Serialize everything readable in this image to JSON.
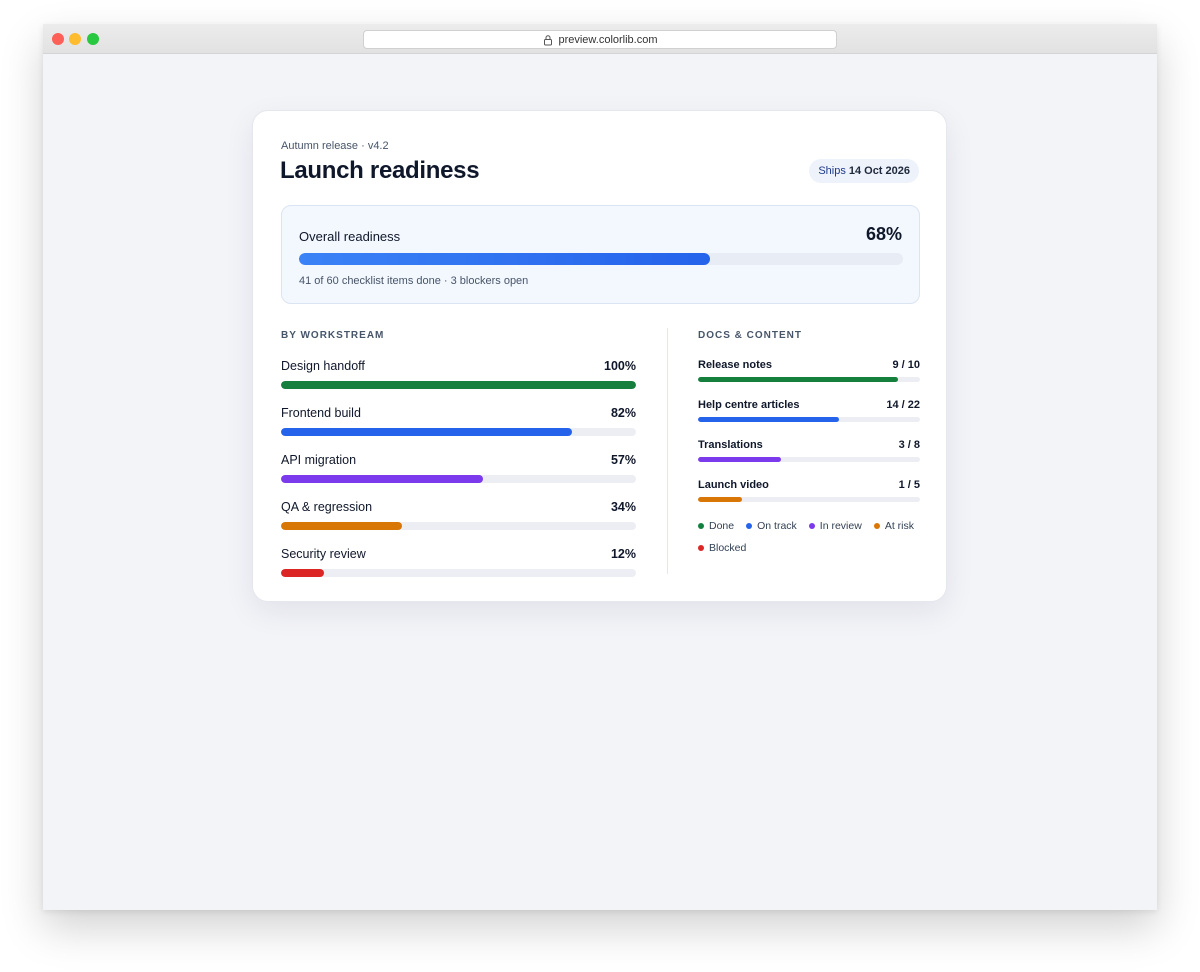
{
  "browser": {
    "url": "preview.colorlib.com"
  },
  "header": {
    "eyebrow": "Autumn release · v4.2",
    "title": "Launch readiness",
    "ship_prefix": "Ships",
    "ship_date": "14 Oct 2026"
  },
  "overall": {
    "label": "Overall readiness",
    "percent_label": "68%",
    "percent": 68,
    "summary": "41 of 60 checklist items done · 3 blockers open"
  },
  "workstreams": {
    "heading": "BY WORKSTREAM",
    "items": [
      {
        "label": "Design handoff",
        "percent_label": "100%",
        "percent": 100,
        "color": "#15803d"
      },
      {
        "label": "Frontend build",
        "percent_label": "82%",
        "percent": 82,
        "color": "#2563eb"
      },
      {
        "label": "API migration",
        "percent_label": "57%",
        "percent": 57,
        "color": "#7c3aed"
      },
      {
        "label": "QA & regression",
        "percent_label": "34%",
        "percent": 34,
        "color": "#d97706"
      },
      {
        "label": "Security review",
        "percent_label": "12%",
        "percent": 12,
        "color": "#dc2626"
      }
    ]
  },
  "docs": {
    "heading": "DOCS & CONTENT",
    "items": [
      {
        "label": "Release notes",
        "count": "9 / 10",
        "done": 9,
        "total": 10,
        "color": "#15803d"
      },
      {
        "label": "Help centre articles",
        "count": "14 / 22",
        "done": 14,
        "total": 22,
        "color": "#2563eb"
      },
      {
        "label": "Translations",
        "count": "3 / 8",
        "done": 3,
        "total": 8,
        "color": "#7c3aed"
      },
      {
        "label": "Launch video",
        "count": "1 / 5",
        "done": 1,
        "total": 5,
        "color": "#d97706"
      }
    ]
  },
  "legend": [
    {
      "label": "Done",
      "color": "#15803d"
    },
    {
      "label": "On track",
      "color": "#2563eb"
    },
    {
      "label": "In review",
      "color": "#7c3aed"
    },
    {
      "label": "At risk",
      "color": "#d97706"
    },
    {
      "label": "Blocked",
      "color": "#dc2626"
    }
  ]
}
